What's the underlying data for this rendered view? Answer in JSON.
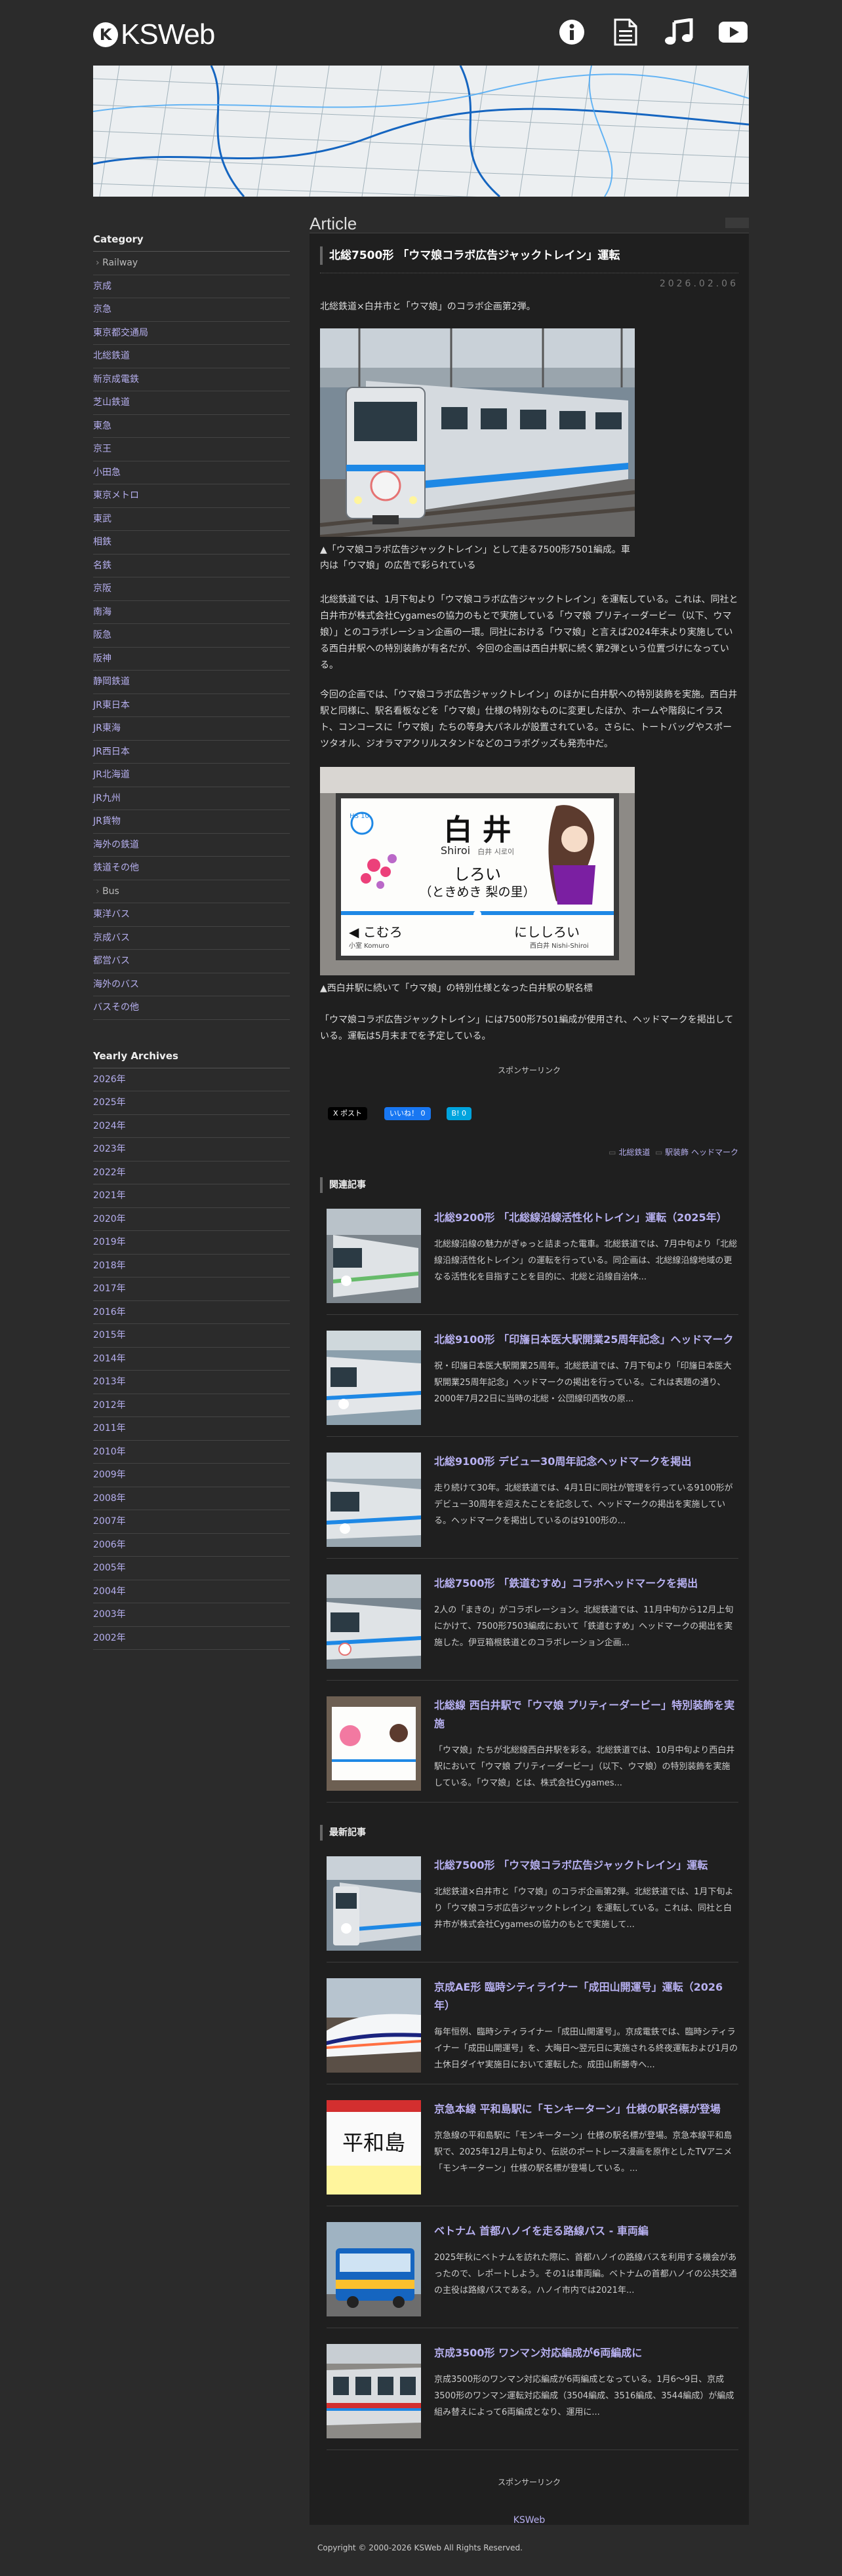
{
  "site": {
    "logo_mark": "K",
    "logo_text": "KSWeb",
    "header_icons": [
      "info-icon",
      "document-icon",
      "music-icon",
      "youtube-icon"
    ],
    "accent": "#b7b0f0"
  },
  "sidebar": {
    "category_heading": "Category",
    "railway_group": "Railway",
    "railway_items": [
      "京成",
      "京急",
      "東京都交通局",
      "北総鉄道",
      "新京成電鉄",
      "芝山鉄道",
      "東急",
      "京王",
      "小田急",
      "東京メトロ",
      "東武",
      "相鉄",
      "名鉄",
      "京阪",
      "南海",
      "阪急",
      "阪神",
      "静岡鉄道",
      "JR東日本",
      "JR東海",
      "JR西日本",
      "JR北海道",
      "JR九州",
      "JR貨物",
      "海外の鉄道",
      "鉄道その他"
    ],
    "bus_group": "Bus",
    "bus_items": [
      "東洋バス",
      "京成バス",
      "都営バス",
      "海外のバス",
      "バスその他"
    ],
    "archives_heading": "Yearly Archives",
    "archive_items": [
      "2026年",
      "2025年",
      "2024年",
      "2023年",
      "2022年",
      "2021年",
      "2020年",
      "2019年",
      "2018年",
      "2017年",
      "2016年",
      "2015年",
      "2014年",
      "2013年",
      "2012年",
      "2011年",
      "2010年",
      "2009年",
      "2008年",
      "2007年",
      "2006年",
      "2005年",
      "2004年",
      "2003年",
      "2002年"
    ]
  },
  "main": {
    "section_title": "Article",
    "article": {
      "title": "北総7500形 「ウマ娘コラボ広告ジャックトレイン」運転",
      "date": "2026.02.06",
      "lead": "北総鉄道×白井市と「ウマ娘」のコラボ企画第2弾。",
      "caption1": "▲「ウマ娘コラボ広告ジャックトレイン」として走る7500形7501編成。車内は「ウマ娘」の広告で彩られている",
      "para1": "北総鉄道では、1月下旬より「ウマ娘コラボ広告ジャックトレイン」を運転している。これは、同社と白井市が株式会社Cygamesの協力のもとで実施している「ウマ娘 プリティーダービー（以下、ウマ娘）」とのコラボレーション企画の一環。同社における「ウマ娘」と言えば2024年末より実施している西白井駅への特別装飾が有名だが、今回の企画は西白井駅に続く第2弾という位置づけになっている。",
      "para2": "今回の企画では、「ウマ娘コラボ広告ジャックトレイン」のほかに白井駅への特別装飾を実施。西白井駅と同様に、駅名看板などを「ウマ娘」仕様の特別なものに変更したほか、ホームや階段にイラスト、コンコースに「ウマ娘」たちの等身大パネルが設置されている。さらに、トートバッグやスポーツタオル、ジオラマアクリルスタンドなどのコラボグッズも発売中だ。",
      "caption2": "▲西白井駅に続いて「ウマ娘」の特別仕様となった白井駅の駅名標",
      "para3": "「ウマ娘コラボ広告ジャックトレイン」には7500形7501編成が使用され、ヘッドマークを掲出している。運転は5月末までを予定している。",
      "sponsor": "スポンサーリンク",
      "share_x": "X ポスト",
      "share_fb": "いいね！ 0",
      "share_hb": "B! 0",
      "tag1": "北総鉄道",
      "tag2": "駅装飾 ヘッドマーク",
      "station_sign": {
        "num": "HS 10",
        "kanji": "白 井",
        "roman": "Shiroi",
        "sub": "白井 시로이",
        "kana": "しろい",
        "note": "（ときめき 梨の里）",
        "left": "こむろ",
        "left_sub": "小室 Komuro",
        "right": "にししろい",
        "right_sub": "西白井 Nishi-Shiroi"
      }
    },
    "related_heading": "関連記事",
    "related": [
      {
        "title": "北総9200形 「北総線沿線活性化トレイン」運転（2025年）",
        "desc": "北総線沿線の魅力がぎゅっと詰まった電車。北総鉄道では、7月中旬より「北総線沿線活性化トレイン」の運転を行っている。同企画は、北総線沿線地域の更なる活性化を目指すことを目的に、北総と沿線自治体..."
      },
      {
        "title": "北総9100形 「印旛日本医大駅開業25周年記念」ヘッドマーク",
        "desc": "祝・印旛日本医大駅開業25周年。北総鉄道では、7月下旬より「印旛日本医大駅開業25周年記念」ヘッドマークの掲出を行っている。これは表題の通り、2000年7月22日に当時の北総・公団線印西牧の原..."
      },
      {
        "title": "北総9100形 デビュー30周年記念ヘッドマークを掲出",
        "desc": "走り続けて30年。北総鉄道では、4月1日に同社が管理を行っている9100形がデビュー30周年を迎えたことを記念して、ヘッドマークの掲出を実施している。ヘッドマークを掲出しているのは9100形の..."
      },
      {
        "title": "北総7500形 「鉄道むすめ」コラボヘッドマークを掲出",
        "desc": "2人の「まきの」がコラボレーション。北総鉄道では、11月中旬から12月上旬にかけて、7500形7503編成において「鉄道むすめ」ヘッドマークの掲出を実施した。伊豆箱根鉄道とのコラボレーション企画..."
      },
      {
        "title": "北総線 西白井駅で「ウマ娘 プリティーダービー」特別装飾を実施",
        "desc": "「ウマ娘」たちが北総線西白井駅を彩る。北総鉄道では、10月中旬より西白井駅において「ウマ娘 プリティーダービー」（以下、ウマ娘）の特別装飾を実施している。「ウマ娘」とは、株式会社Cygames..."
      }
    ],
    "latest_heading": "最新記事",
    "latest": [
      {
        "title": "北総7500形 「ウマ娘コラボ広告ジャックトレイン」運転",
        "desc": "北総鉄道×白井市と「ウマ娘」のコラボ企画第2弾。北総鉄道では、1月下旬より「ウマ娘コラボ広告ジャックトレイン」を運転している。これは、同社と白井市が株式会社Cygamesの協力のもとで実施して..."
      },
      {
        "title": "京成AE形 臨時シティライナー「成田山開運号」運転（2026年）",
        "desc": "毎年恒例、臨時シティライナー「成田山開運号」。京成電鉄では、臨時シティライナー「成田山開運号」を、大晦日〜翌元日に実施される終夜運転および1月の土休日ダイヤ実施日において運転した。成田山新勝寺へ..."
      },
      {
        "title": "京急本線 平和島駅に「モンキーターン」仕様の駅名標が登場",
        "desc": "京急線の平和島駅に「モンキーターン」仕様の駅名標が登場。京急本線平和島駅で、2025年12月上旬より、伝説のボートレース漫画を原作としたTVアニメ「モンキーターン」仕様の駅名標が登場している。..."
      },
      {
        "title": "ベトナム 首都ハノイを走る路線バス - 車両編",
        "desc": "2025年秋にベトナムを訪れた際に、首都ハノイの路線バスを利用する機会があったので、レポートしよう。その1は車両編。ベトナムの首都ハノイの公共交通の主役は路線バスである。ハノイ市内では2021年..."
      },
      {
        "title": "京成3500形 ワンマン対応編成が6両編成に",
        "desc": "京成3500形のワンマン対応編成が6両編成となっている。1月6〜9日、京成3500形のワンマン運転対応編成（3504編成、3516編成、3544編成）が編成組み替えによって6両編成となり、運用に..."
      }
    ],
    "footer_sponsor": "スポンサーリンク",
    "footer_link": "KSWeb"
  },
  "copyright": "Copyright © 2000-2026 KSWeb All Rights Reserved."
}
